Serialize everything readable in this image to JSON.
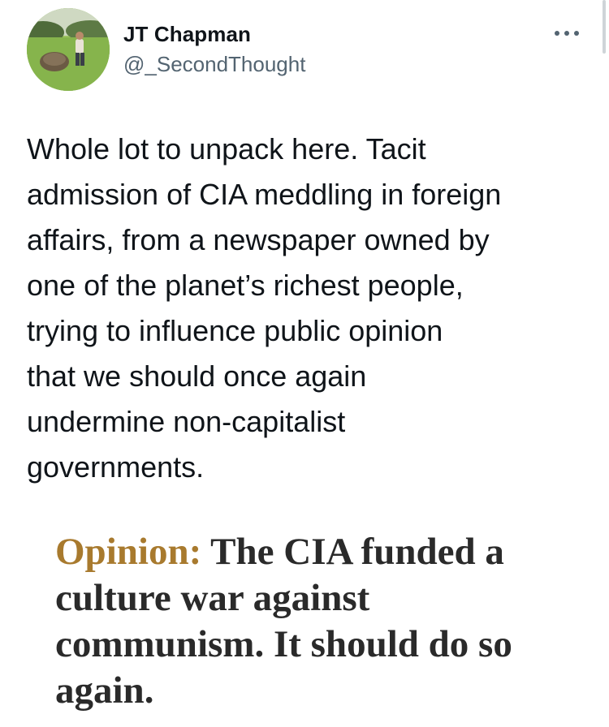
{
  "author": {
    "name": "JT Chapman",
    "handle": "@_SecondThought"
  },
  "tweet": {
    "text": "Whole lot to unpack here. Tacit\nadmission of CIA meddling in foreign\naffairs, from a newspaper owned by\none of the planet’s richest people,\ntrying to influence public opinion\nthat we should once again\nundermine non-capitalist\ngovernments."
  },
  "article": {
    "kicker": "Opinion:",
    "headline": "The CIA funded a culture war against communism. It should do so again."
  },
  "icons": {
    "more": "more-horizontal-icon",
    "avatar": "avatar-photo"
  },
  "colors": {
    "text_primary": "#0f1419",
    "text_secondary": "#536471",
    "kicker": "#a87a2e",
    "headline": "#2a2a2a"
  }
}
